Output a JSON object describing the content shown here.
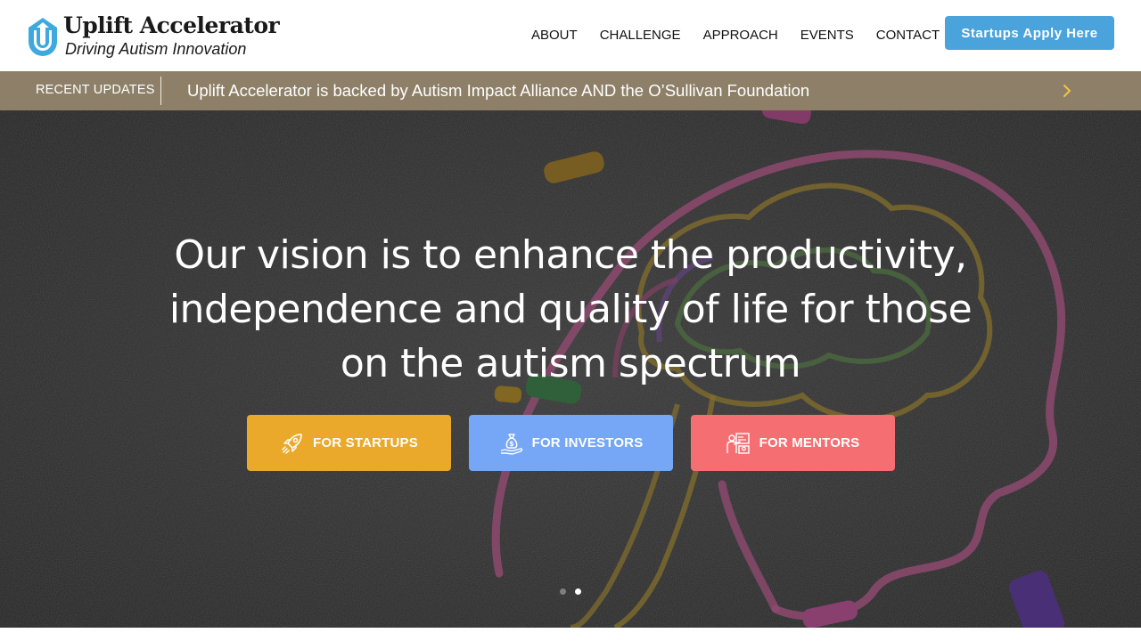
{
  "brand": {
    "name": "Uplift Accelerator",
    "tagline": "Driving Autism Innovation",
    "logo_icon": "u-arrow-logo-icon",
    "color": "#3ea9de"
  },
  "nav": {
    "items": [
      {
        "label": "ABOUT"
      },
      {
        "label": "CHALLENGE"
      },
      {
        "label": "APPROACH"
      },
      {
        "label": "EVENTS"
      },
      {
        "label": "CONTACT"
      }
    ],
    "cta_label": "Startups Apply Here",
    "cta_color": "#4ba3dc"
  },
  "ticker": {
    "label": "RECENT UPDATES",
    "text": "Uplift Accelerator is backed by Autism Impact Alliance AND the O’Sullivan Foundation",
    "next_icon": "chevron-right-icon",
    "background": "#8e8068",
    "arrow_color": "#f3c24a"
  },
  "hero": {
    "title": "Our vision is to enhance the productivity, independence and quality of life for those on the autism spectrum",
    "background_image": "chalk-brain-drawing",
    "buttons": [
      {
        "label": "FOR STARTUPS",
        "icon": "rocket-icon",
        "color": "#eaa92a"
      },
      {
        "label": "FOR INVESTORS",
        "icon": "money-bag-hand-icon",
        "color": "#76a6f6"
      },
      {
        "label": "FOR MENTORS",
        "icon": "mentor-board-icon",
        "color": "#f56f72"
      }
    ],
    "slides": {
      "count": 2,
      "active": 2
    }
  }
}
